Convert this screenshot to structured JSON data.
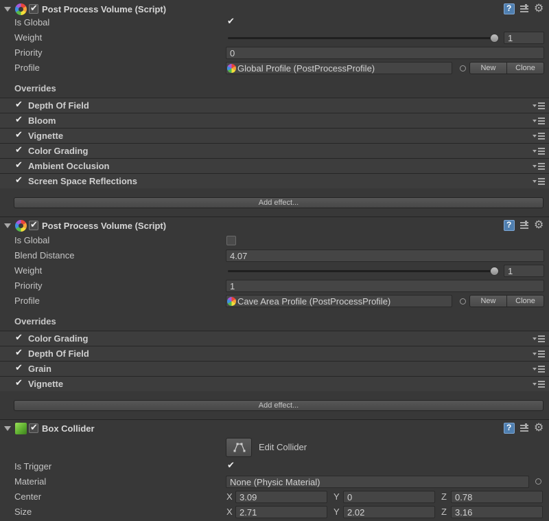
{
  "components": [
    {
      "title": "Post Process Volume (Script)",
      "enabled": true,
      "is_global_label": "Is Global",
      "is_global": true,
      "weight_label": "Weight",
      "weight_value": "1",
      "weight_fraction": 1.0,
      "priority_label": "Priority",
      "priority_value": "0",
      "profile_label": "Profile",
      "profile_value": "Global Profile (PostProcessProfile)",
      "new_label": "New",
      "clone_label": "Clone",
      "overrides_label": "Overrides",
      "overrides": [
        {
          "name": "Depth Of Field",
          "enabled": true
        },
        {
          "name": "Bloom",
          "enabled": true
        },
        {
          "name": "Vignette",
          "enabled": true
        },
        {
          "name": "Color Grading",
          "enabled": true
        },
        {
          "name": "Ambient Occlusion",
          "enabled": true
        },
        {
          "name": "Screen Space Reflections",
          "enabled": true
        }
      ],
      "add_effect_label": "Add effect..."
    },
    {
      "title": "Post Process Volume (Script)",
      "enabled": true,
      "is_global_label": "Is Global",
      "is_global": false,
      "blend_distance_label": "Blend Distance",
      "blend_distance_value": "4.07",
      "weight_label": "Weight",
      "weight_value": "1",
      "weight_fraction": 1.0,
      "priority_label": "Priority",
      "priority_value": "1",
      "profile_label": "Profile",
      "profile_value": "Cave Area Profile (PostProcessProfile)",
      "new_label": "New",
      "clone_label": "Clone",
      "overrides_label": "Overrides",
      "overrides": [
        {
          "name": "Color Grading",
          "enabled": true
        },
        {
          "name": "Depth Of Field",
          "enabled": true
        },
        {
          "name": "Grain",
          "enabled": true
        },
        {
          "name": "Vignette",
          "enabled": true
        }
      ],
      "add_effect_label": "Add effect..."
    },
    {
      "title": "Box Collider",
      "enabled": true,
      "edit_collider_label": "Edit Collider",
      "is_trigger_label": "Is Trigger",
      "is_trigger": true,
      "material_label": "Material",
      "material_value": "None (Physic Material)",
      "center_label": "Center",
      "center": {
        "x": "3.09",
        "y": "0",
        "z": "0.78"
      },
      "size_label": "Size",
      "size": {
        "x": "2.71",
        "y": "2.02",
        "z": "3.16"
      },
      "axis_labels": {
        "x": "X",
        "y": "Y",
        "z": "Z"
      }
    }
  ],
  "icons": {
    "foldout": "foldout-triangle-icon",
    "post_process": "post-process-volume-icon",
    "box_collider": "box-collider-icon",
    "help": "help-icon",
    "preset": "preset-icon",
    "settings": "gear-icon",
    "override_menu": "override-menu-icon",
    "object_picker": "object-picker-icon",
    "edit_collider": "edit-collider-icon"
  },
  "colors": {
    "background": "#383838",
    "override_row": "#3d3d3d",
    "field": "#454545",
    "text": "#c8c8c8",
    "help_blue": "#4f7fb0"
  }
}
